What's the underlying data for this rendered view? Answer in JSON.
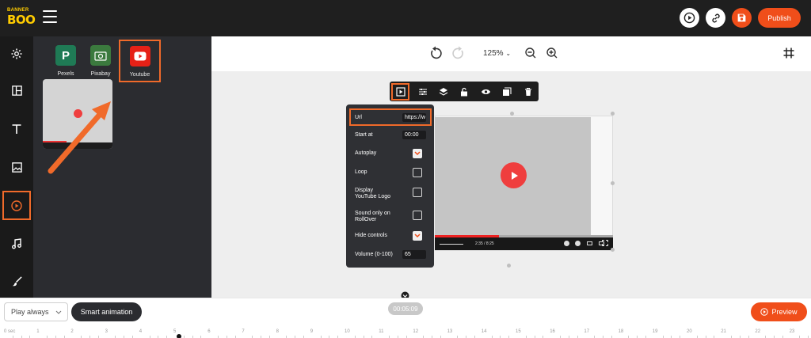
{
  "app": {
    "logo_line1": "BANNER",
    "logo_line2": "BOO"
  },
  "header": {
    "publish_label": "Publish"
  },
  "sidebar": {
    "items": [
      {
        "name": "settings"
      },
      {
        "name": "layout"
      },
      {
        "name": "text"
      },
      {
        "name": "image"
      },
      {
        "name": "video"
      },
      {
        "name": "audio"
      },
      {
        "name": "brush"
      }
    ]
  },
  "panel": {
    "sources": [
      {
        "label": "Pexels",
        "color": "#1f7a55"
      },
      {
        "label": "Pixabay",
        "color": "#3b7a3e"
      },
      {
        "label": "Youtube",
        "color": "#e62117"
      }
    ]
  },
  "canvas": {
    "zoom": "125%"
  },
  "video_settings": {
    "url_label": "Url",
    "url_value": "https://w",
    "start_label": "Start at",
    "start_value": "00:00",
    "autoplay_label": "Autoplay",
    "autoplay": true,
    "loop_label": "Loop",
    "loop": false,
    "logo_label_1": "Display",
    "logo_label_2": "YouTube Logo",
    "logo": false,
    "sound_label_1": "Sound only on",
    "sound_label_2": "RollOver",
    "sound": false,
    "hide_controls_label": "Hide controls",
    "hide_controls": true,
    "volume_label": "Volume (0-100)",
    "volume_value": "65"
  },
  "player": {
    "time": "2:35 / 8:25",
    "progress": 0.36
  },
  "bottom": {
    "play_select": "Play always",
    "smart_animation": "Smart animation",
    "duration": "00:05:09",
    "preview_label": "Preview"
  },
  "timeline": {
    "ticks": [
      "0 sec",
      "1",
      "2",
      "3",
      "4",
      "5",
      "6",
      "7",
      "8",
      "9",
      "10",
      "11",
      "12",
      "13",
      "14",
      "15",
      "16",
      "17",
      "18",
      "19",
      "20",
      "21",
      "22",
      "23"
    ]
  },
  "colors": {
    "accent": "#f04e1a",
    "highlight": "#f06a2a",
    "youtube_red": "#ef3e3e"
  }
}
